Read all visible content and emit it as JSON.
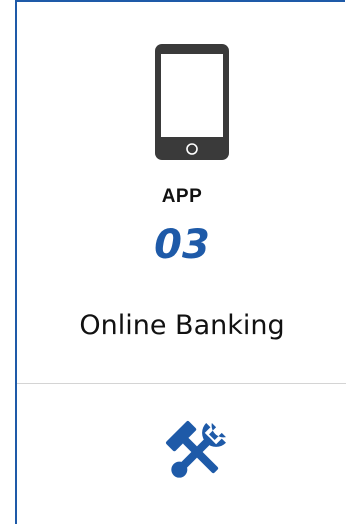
{
  "card": {
    "category": "APP",
    "number": "03",
    "title": "Online Banking"
  },
  "icons": {
    "top": "smartphone-icon",
    "bottom": "tools-icon"
  },
  "colors": {
    "accent": "#1e5aa8",
    "phone": "#3a3a3a",
    "divider": "#d4d4d4"
  }
}
